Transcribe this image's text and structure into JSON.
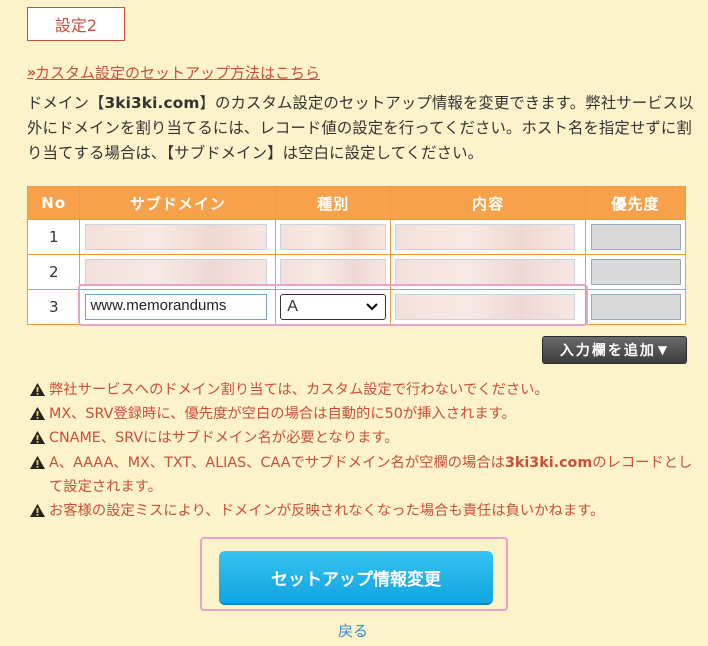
{
  "section": {
    "tab_label": "設定2"
  },
  "guide_link": {
    "text": "カスタム設定のセットアップ方法はこちら"
  },
  "description": {
    "before": "ドメイン【",
    "domain": "3ki3ki.com",
    "after": "】のカスタム設定のセットアップ情報を変更できます。弊社サービス以外にドメインを割り当てるには、レコード値の設定を行ってください。ホスト名を指定せずに割り当てする場合は、【サブドメイン】は空白に設定してください。"
  },
  "table": {
    "headers": {
      "no": "No",
      "subdomain": "サブドメイン",
      "type": "種別",
      "content": "内容",
      "priority": "優先度"
    },
    "rows": [
      {
        "no": "1",
        "subdomain": "",
        "type": "",
        "content": ""
      },
      {
        "no": "2",
        "subdomain": "",
        "type": "",
        "content": ""
      },
      {
        "no": "3",
        "subdomain": "www.memorandums",
        "type": "A",
        "content": ""
      }
    ]
  },
  "add_button": {
    "label": "入力欄を追加"
  },
  "notes": [
    "弊社サービスへのドメイン割り当ては、カスタム設定で行わないでください。",
    "MX、SRV登録時に、優先度が空白の場合は自動的に50が挿入されます。",
    "CNAME、SRVにはサブドメイン名が必要となります。",
    {
      "before": "A、AAAA、MX、TXT、ALIAS、CAAでサブドメイン名が空欄の場合は",
      "domain": "3ki3ki.com",
      "after": "のレコードとして設定されます。"
    },
    "お客様の設定ミスにより、ドメインが反映されなくなった場合も責任は負いかねます。"
  ],
  "submit": {
    "label": "セットアップ情報変更"
  },
  "back_link": {
    "label": "戻る"
  },
  "colors": {
    "accent": "#c8503a",
    "header": "#f7a24b",
    "button": "#11a4e0",
    "background": "#fdf3cb",
    "highlight": "#e8a3c8"
  }
}
